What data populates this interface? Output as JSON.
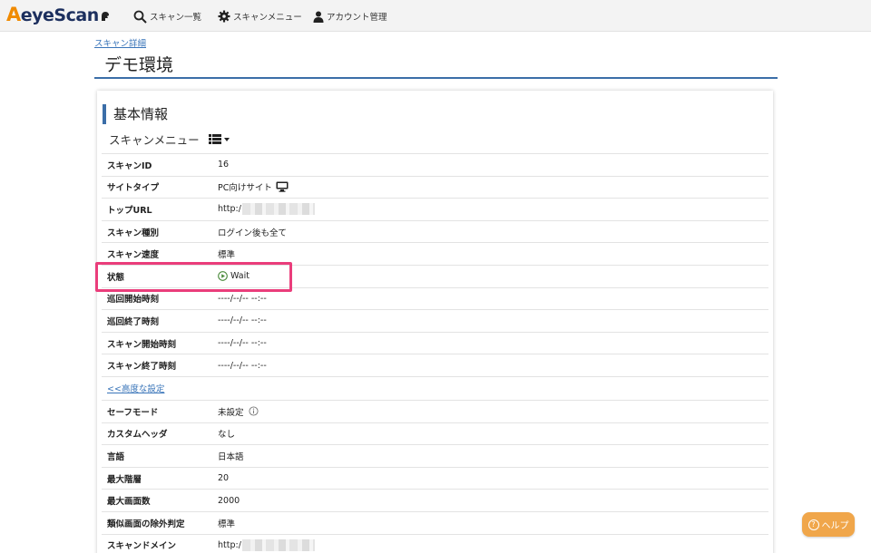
{
  "brand": {
    "logo_a": "A",
    "logo_rest": "eyeScan"
  },
  "nav": {
    "scan_list": "スキャン一覧",
    "scan_menu": "スキャンメニュー",
    "account": "アカウント管理"
  },
  "breadcrumb": "スキャン詳細",
  "page_title": "デモ環境",
  "section": {
    "title": "基本情報",
    "menu_label": "スキャンメニュー"
  },
  "basic_rows": [
    {
      "key": "スキャンID",
      "value": "16"
    },
    {
      "key": "サイトタイプ",
      "value": "PC向けサイト"
    },
    {
      "key": "トップURL",
      "value": "http:/"
    },
    {
      "key": "スキャン種別",
      "value": "ログイン後も全て"
    },
    {
      "key": "スキャン速度",
      "value": "標準"
    },
    {
      "key": "状態",
      "value": "Wait"
    },
    {
      "key": "巡回開始時刻",
      "value": "----/--/-- --:--"
    },
    {
      "key": "巡回終了時刻",
      "value": "----/--/-- --:--"
    },
    {
      "key": "スキャン開始時刻",
      "value": "----/--/-- --:--"
    },
    {
      "key": "スキャン終了時刻",
      "value": "----/--/-- --:--"
    }
  ],
  "advanced_link": "<<高度な設定",
  "advanced_rows": [
    {
      "key": "セーフモード",
      "value": "未設定"
    },
    {
      "key": "カスタムヘッダ",
      "value": "なし"
    },
    {
      "key": "言語",
      "value": "日本語"
    },
    {
      "key": "最大階層",
      "value": "20"
    },
    {
      "key": "最大画面数",
      "value": "2000"
    },
    {
      "key": "類似画面の除外判定",
      "value": "標準"
    },
    {
      "key": "スキャンドメイン",
      "value": "http:/"
    }
  ],
  "help": "ヘルプ",
  "colors": {
    "accent": "#3b6ea8",
    "highlight": "#ea3d7b",
    "help": "#f0a64a",
    "brand_orange": "#f08a00",
    "brand_navy": "#1c2f5e"
  }
}
